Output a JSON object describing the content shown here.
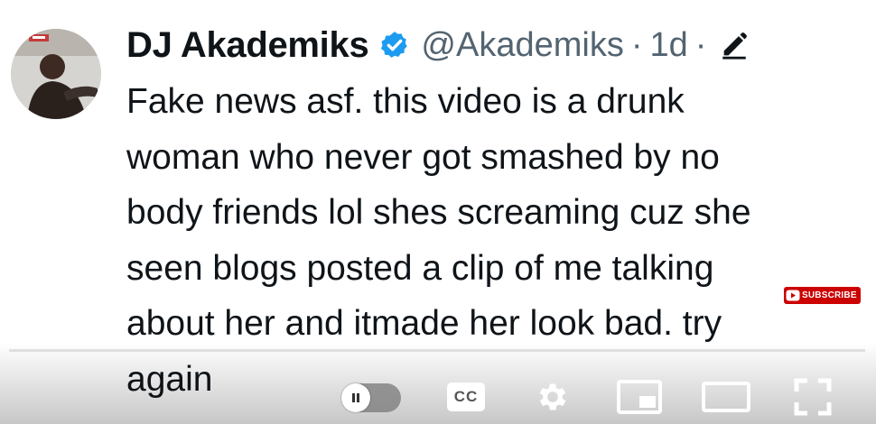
{
  "tweet": {
    "display_name": "DJ Akademiks",
    "handle": "@Akademiks",
    "separator": "·",
    "time": "1d",
    "separator2": "·",
    "lines": [
      "Fake news asf. this video is a drunk",
      "woman who never got smashed by no",
      "body friends lol shes screaming cuz she",
      "seen blogs posted a clip of me talking",
      "about her and itmade her look bad. try",
      "again"
    ]
  },
  "overlay": {
    "subscribe_label": "SUBSCRIBE"
  },
  "player": {
    "captions_label": "CC",
    "progress": 0
  },
  "icons": {
    "verified": "verified-badge-icon",
    "edit": "pencil-icon",
    "autoplay": "pause-icon",
    "settings": "gear-icon",
    "miniplayer": "miniplayer-icon",
    "theater": "theater-mode-icon",
    "fullscreen": "fullscreen-icon"
  },
  "colors": {
    "verified_blue": "#1d9bf0",
    "subscribe_red": "#cc0000",
    "text": "#0f1419",
    "muted": "#536471"
  }
}
